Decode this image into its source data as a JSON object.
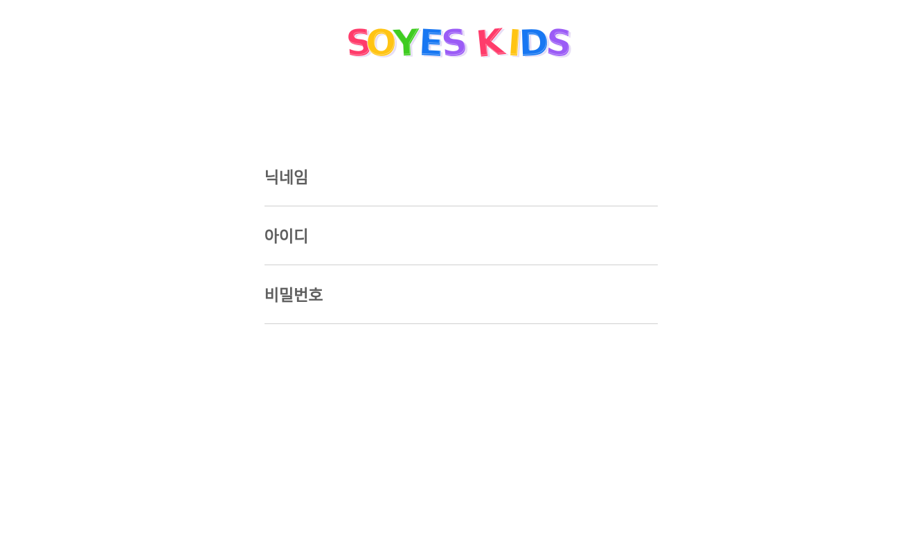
{
  "logo": {
    "text": "SOYES KIDS",
    "letters": [
      {
        "char": "S",
        "color": "#ff3b6b"
      },
      {
        "char": "O",
        "color": "#ffc414"
      },
      {
        "char": "Y",
        "color": "#3fcc21"
      },
      {
        "char": "E",
        "color": "#1877f2"
      },
      {
        "char": "S",
        "color": "#9b5cf6"
      },
      {
        "char": "K",
        "color": "#ff3b6b"
      },
      {
        "char": "I",
        "color": "#ffc414"
      },
      {
        "char": "D",
        "color": "#1877f2"
      },
      {
        "char": "S",
        "color": "#9b5cf6"
      }
    ]
  },
  "form": {
    "nickname": {
      "label": "닉네임",
      "value": ""
    },
    "user_id": {
      "label": "아이디",
      "value": ""
    },
    "password": {
      "label": "비밀번호",
      "value": ""
    }
  },
  "colors": {
    "label": "#5f5f5f",
    "divider": "#cfcfcf",
    "background": "#ffffff"
  }
}
